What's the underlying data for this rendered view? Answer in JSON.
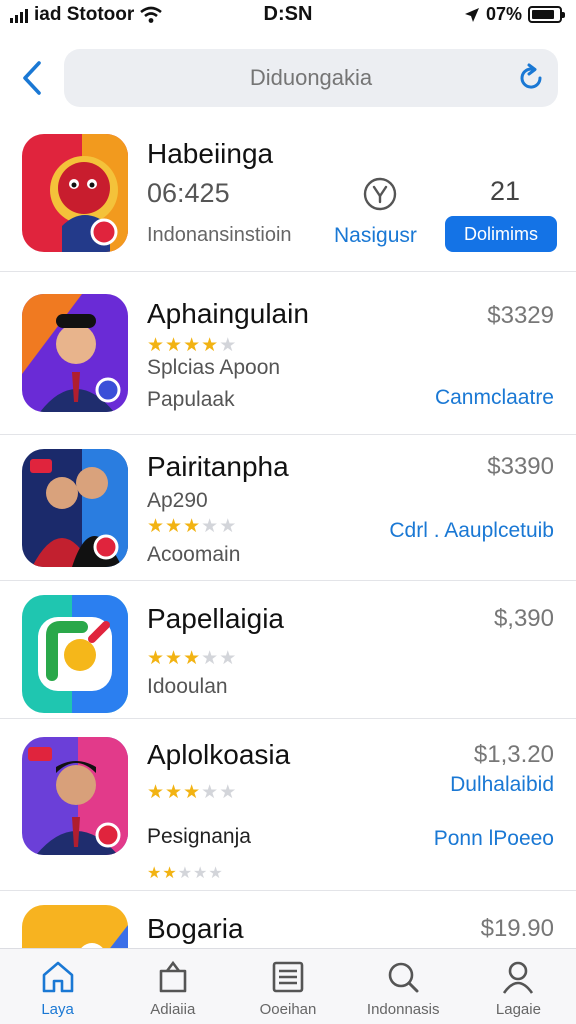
{
  "status_bar": {
    "carrier": "iad Stotoor",
    "time": "D:SN",
    "battery_text": "07%",
    "battery_level": 0.85
  },
  "header": {
    "search_placeholder": "Diduongakia"
  },
  "rows": [
    {
      "name": "Habeiinga",
      "time": "06:425",
      "subtitle": "Indonansinstioin",
      "count": "21",
      "link": "Nasigusr",
      "button": "Dolimims",
      "colors": [
        "#e0243d",
        "#f29a1e"
      ]
    },
    {
      "name": "Aphaingulain",
      "rating": 4,
      "line1": "Splcias Apoon",
      "line2": "Papulaak",
      "price": "$3329",
      "link": "Canmclaatre",
      "colors": [
        "#6a2bd6",
        "#f07a21"
      ]
    },
    {
      "name": "Pairitanpha",
      "line0": "Ap290",
      "rating": 3,
      "line2": "Acoomain",
      "price": "$3390",
      "link": "Cdrl . Aauplcetuib",
      "colors": [
        "#1b2a6b",
        "#2a7de0"
      ]
    },
    {
      "name": "Papellaigia",
      "rating": 2.5,
      "line2": "Idooulan",
      "price": "$,390",
      "colors": [
        "#1fc6b0",
        "#2b7ff0"
      ]
    },
    {
      "name": "Aplolkoasia",
      "rating": 3,
      "line1": "Pesignanja",
      "price": "$1,3.20",
      "link": "Dulhalaibid",
      "link2": "Ponn lPoeeo",
      "rating2": 2,
      "colors": [
        "#6b3fd8",
        "#e23a8a"
      ]
    },
    {
      "name": "Bogaria",
      "price": "$19.90",
      "colors": [
        "#f7b320",
        "#3a6fe8"
      ]
    }
  ],
  "tabs": [
    {
      "label": "Laya",
      "icon": "home-icon",
      "active": true
    },
    {
      "label": "Adiaiia",
      "icon": "bag-icon",
      "active": false
    },
    {
      "label": "Ooeihan",
      "icon": "list-icon",
      "active": false
    },
    {
      "label": "Indonnasis",
      "icon": "search-icon",
      "active": false
    },
    {
      "label": "Lagaie",
      "icon": "person-icon",
      "active": false
    }
  ],
  "colors": {
    "accent": "#1473e6",
    "link": "#1a78d4",
    "star": "#f2b313"
  }
}
